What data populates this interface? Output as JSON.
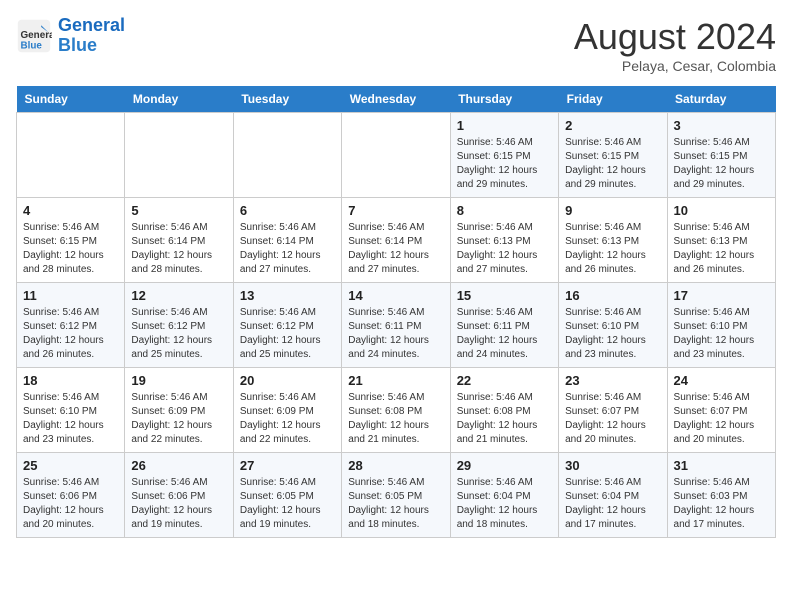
{
  "header": {
    "logo_line1": "General",
    "logo_line2": "Blue",
    "month_year": "August 2024",
    "location": "Pelaya, Cesar, Colombia"
  },
  "days_of_week": [
    "Sunday",
    "Monday",
    "Tuesday",
    "Wednesday",
    "Thursday",
    "Friday",
    "Saturday"
  ],
  "weeks": [
    [
      {
        "day": "",
        "info": ""
      },
      {
        "day": "",
        "info": ""
      },
      {
        "day": "",
        "info": ""
      },
      {
        "day": "",
        "info": ""
      },
      {
        "day": "1",
        "info": "Sunrise: 5:46 AM\nSunset: 6:15 PM\nDaylight: 12 hours\nand 29 minutes."
      },
      {
        "day": "2",
        "info": "Sunrise: 5:46 AM\nSunset: 6:15 PM\nDaylight: 12 hours\nand 29 minutes."
      },
      {
        "day": "3",
        "info": "Sunrise: 5:46 AM\nSunset: 6:15 PM\nDaylight: 12 hours\nand 29 minutes."
      }
    ],
    [
      {
        "day": "4",
        "info": "Sunrise: 5:46 AM\nSunset: 6:15 PM\nDaylight: 12 hours\nand 28 minutes."
      },
      {
        "day": "5",
        "info": "Sunrise: 5:46 AM\nSunset: 6:14 PM\nDaylight: 12 hours\nand 28 minutes."
      },
      {
        "day": "6",
        "info": "Sunrise: 5:46 AM\nSunset: 6:14 PM\nDaylight: 12 hours\nand 27 minutes."
      },
      {
        "day": "7",
        "info": "Sunrise: 5:46 AM\nSunset: 6:14 PM\nDaylight: 12 hours\nand 27 minutes."
      },
      {
        "day": "8",
        "info": "Sunrise: 5:46 AM\nSunset: 6:13 PM\nDaylight: 12 hours\nand 27 minutes."
      },
      {
        "day": "9",
        "info": "Sunrise: 5:46 AM\nSunset: 6:13 PM\nDaylight: 12 hours\nand 26 minutes."
      },
      {
        "day": "10",
        "info": "Sunrise: 5:46 AM\nSunset: 6:13 PM\nDaylight: 12 hours\nand 26 minutes."
      }
    ],
    [
      {
        "day": "11",
        "info": "Sunrise: 5:46 AM\nSunset: 6:12 PM\nDaylight: 12 hours\nand 26 minutes."
      },
      {
        "day": "12",
        "info": "Sunrise: 5:46 AM\nSunset: 6:12 PM\nDaylight: 12 hours\nand 25 minutes."
      },
      {
        "day": "13",
        "info": "Sunrise: 5:46 AM\nSunset: 6:12 PM\nDaylight: 12 hours\nand 25 minutes."
      },
      {
        "day": "14",
        "info": "Sunrise: 5:46 AM\nSunset: 6:11 PM\nDaylight: 12 hours\nand 24 minutes."
      },
      {
        "day": "15",
        "info": "Sunrise: 5:46 AM\nSunset: 6:11 PM\nDaylight: 12 hours\nand 24 minutes."
      },
      {
        "day": "16",
        "info": "Sunrise: 5:46 AM\nSunset: 6:10 PM\nDaylight: 12 hours\nand 23 minutes."
      },
      {
        "day": "17",
        "info": "Sunrise: 5:46 AM\nSunset: 6:10 PM\nDaylight: 12 hours\nand 23 minutes."
      }
    ],
    [
      {
        "day": "18",
        "info": "Sunrise: 5:46 AM\nSunset: 6:10 PM\nDaylight: 12 hours\nand 23 minutes."
      },
      {
        "day": "19",
        "info": "Sunrise: 5:46 AM\nSunset: 6:09 PM\nDaylight: 12 hours\nand 22 minutes."
      },
      {
        "day": "20",
        "info": "Sunrise: 5:46 AM\nSunset: 6:09 PM\nDaylight: 12 hours\nand 22 minutes."
      },
      {
        "day": "21",
        "info": "Sunrise: 5:46 AM\nSunset: 6:08 PM\nDaylight: 12 hours\nand 21 minutes."
      },
      {
        "day": "22",
        "info": "Sunrise: 5:46 AM\nSunset: 6:08 PM\nDaylight: 12 hours\nand 21 minutes."
      },
      {
        "day": "23",
        "info": "Sunrise: 5:46 AM\nSunset: 6:07 PM\nDaylight: 12 hours\nand 20 minutes."
      },
      {
        "day": "24",
        "info": "Sunrise: 5:46 AM\nSunset: 6:07 PM\nDaylight: 12 hours\nand 20 minutes."
      }
    ],
    [
      {
        "day": "25",
        "info": "Sunrise: 5:46 AM\nSunset: 6:06 PM\nDaylight: 12 hours\nand 20 minutes."
      },
      {
        "day": "26",
        "info": "Sunrise: 5:46 AM\nSunset: 6:06 PM\nDaylight: 12 hours\nand 19 minutes."
      },
      {
        "day": "27",
        "info": "Sunrise: 5:46 AM\nSunset: 6:05 PM\nDaylight: 12 hours\nand 19 minutes."
      },
      {
        "day": "28",
        "info": "Sunrise: 5:46 AM\nSunset: 6:05 PM\nDaylight: 12 hours\nand 18 minutes."
      },
      {
        "day": "29",
        "info": "Sunrise: 5:46 AM\nSunset: 6:04 PM\nDaylight: 12 hours\nand 18 minutes."
      },
      {
        "day": "30",
        "info": "Sunrise: 5:46 AM\nSunset: 6:04 PM\nDaylight: 12 hours\nand 17 minutes."
      },
      {
        "day": "31",
        "info": "Sunrise: 5:46 AM\nSunset: 6:03 PM\nDaylight: 12 hours\nand 17 minutes."
      }
    ]
  ]
}
